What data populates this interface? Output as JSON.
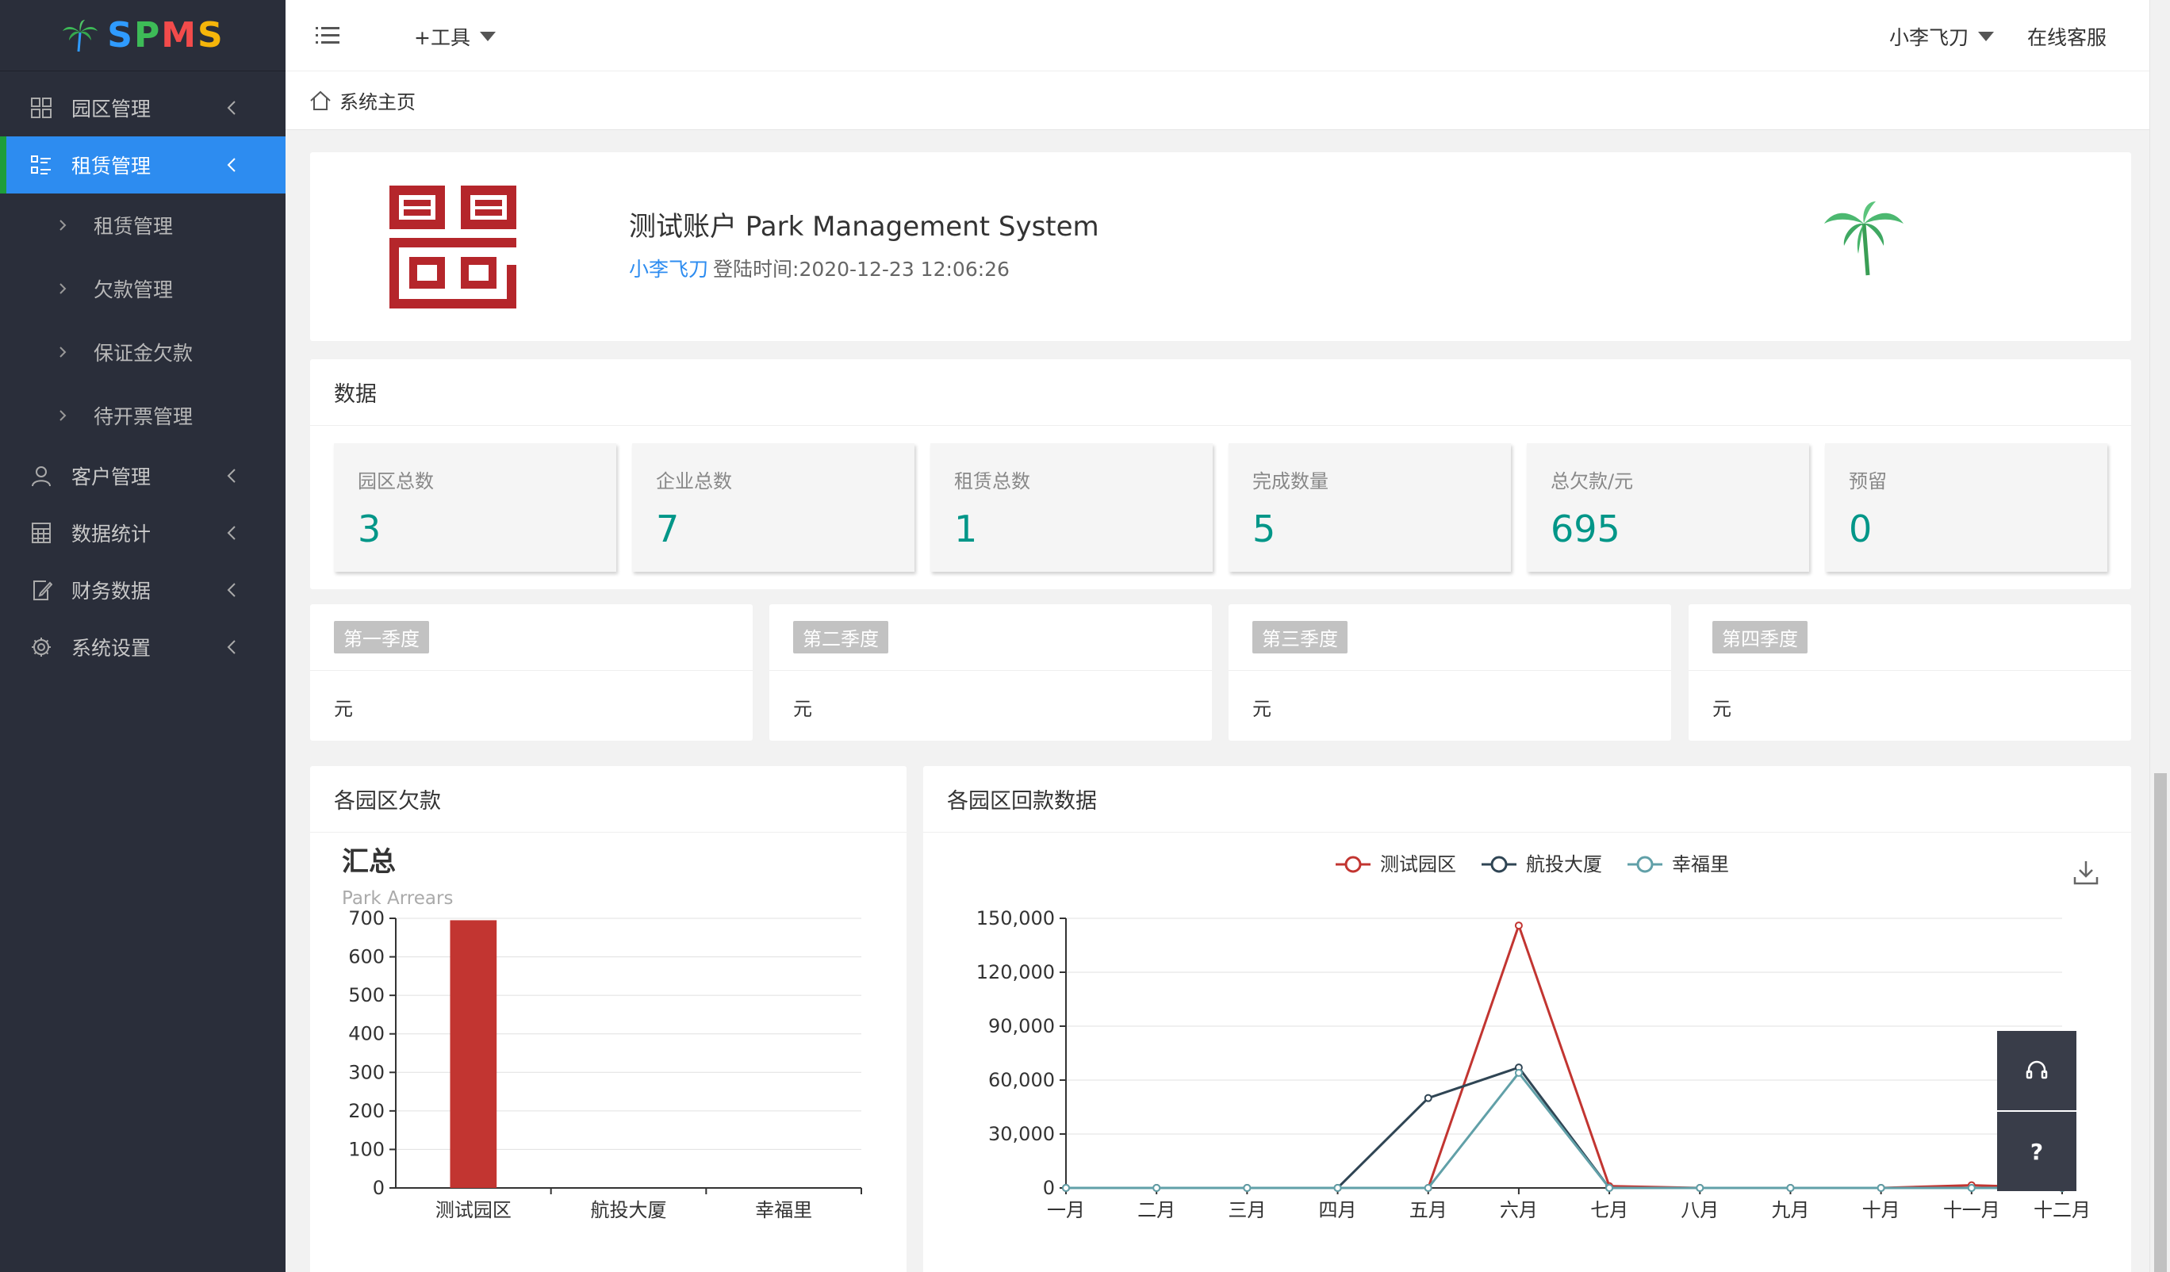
{
  "app": {
    "logo_text": "SPMS",
    "brand_colors": [
      "#2f9bff",
      "#3dbb57",
      "#f24b4b",
      "#f5b50a"
    ]
  },
  "sidebar": {
    "items": [
      {
        "label": "园区管理",
        "icon": "grid-icon"
      },
      {
        "label": "租赁管理",
        "icon": "list-icon",
        "active": true
      },
      {
        "label": "客户管理",
        "icon": "user-icon"
      },
      {
        "label": "数据统计",
        "icon": "calculator-icon"
      },
      {
        "label": "财务数据",
        "icon": "edit-doc-icon"
      },
      {
        "label": "系统设置",
        "icon": "gear-icon"
      }
    ],
    "submenu": [
      "租赁管理",
      "欠款管理",
      "保证金欠款",
      "待开票管理"
    ]
  },
  "header": {
    "tools_label": "+工具",
    "user_label": "小李飞刀",
    "service_label": "在线客服"
  },
  "breadcrumb": {
    "home_label": "系统主页"
  },
  "welcome": {
    "title": "测试账户 Park Management System",
    "username": "小李飞刀",
    "login_text": "登陆时间:2020-12-23 12:06:26"
  },
  "data_section": {
    "title": "数据",
    "stats": [
      {
        "label": "园区总数",
        "value": "3"
      },
      {
        "label": "企业总数",
        "value": "7"
      },
      {
        "label": "租赁总数",
        "value": "1"
      },
      {
        "label": "完成数量",
        "value": "5"
      },
      {
        "label": "总欠款/元",
        "value": "695"
      },
      {
        "label": "预留",
        "value": "0"
      }
    ]
  },
  "quarters": [
    {
      "label": "第一季度",
      "value": "元"
    },
    {
      "label": "第二季度",
      "value": "元"
    },
    {
      "label": "第三季度",
      "value": "元"
    },
    {
      "label": "第四季度",
      "value": "元"
    }
  ],
  "arrears_card": {
    "title": "各园区欠款"
  },
  "returns_card": {
    "title": "各园区回款数据"
  },
  "float_buttons": {
    "help_label": "?"
  },
  "chart_data": [
    {
      "type": "bar",
      "title": "汇总",
      "subtitle": "Park Arrears",
      "categories": [
        "测试园区",
        "航投大厦",
        "幸福里"
      ],
      "values": [
        695,
        0,
        0
      ],
      "ylim": [
        0,
        700
      ],
      "yticks": [
        0,
        100,
        200,
        300,
        400,
        500,
        600,
        700
      ],
      "bar_color": "#c23531"
    },
    {
      "type": "line",
      "categories": [
        "一月",
        "二月",
        "三月",
        "四月",
        "五月",
        "六月",
        "七月",
        "八月",
        "九月",
        "十月",
        "十一月",
        "十二月"
      ],
      "ylim": [
        0,
        150000
      ],
      "yticks": [
        0,
        30000,
        60000,
        90000,
        120000,
        150000
      ],
      "ytick_labels": [
        "0",
        "30,000",
        "60,000",
        "90,000",
        "120,000",
        "150,000"
      ],
      "legend_position": "top",
      "series": [
        {
          "name": "测试园区",
          "color": "#c23531",
          "values": [
            0,
            0,
            0,
            0,
            0,
            146000,
            1000,
            0,
            0,
            0,
            1500,
            0
          ]
        },
        {
          "name": "航投大厦",
          "color": "#2f4554",
          "values": [
            0,
            0,
            0,
            0,
            50000,
            67000,
            0,
            0,
            0,
            0,
            0,
            0
          ]
        },
        {
          "name": "幸福里",
          "color": "#61a0a8",
          "values": [
            0,
            0,
            0,
            0,
            0,
            64000,
            0,
            0,
            0,
            0,
            0,
            0
          ]
        }
      ]
    }
  ]
}
